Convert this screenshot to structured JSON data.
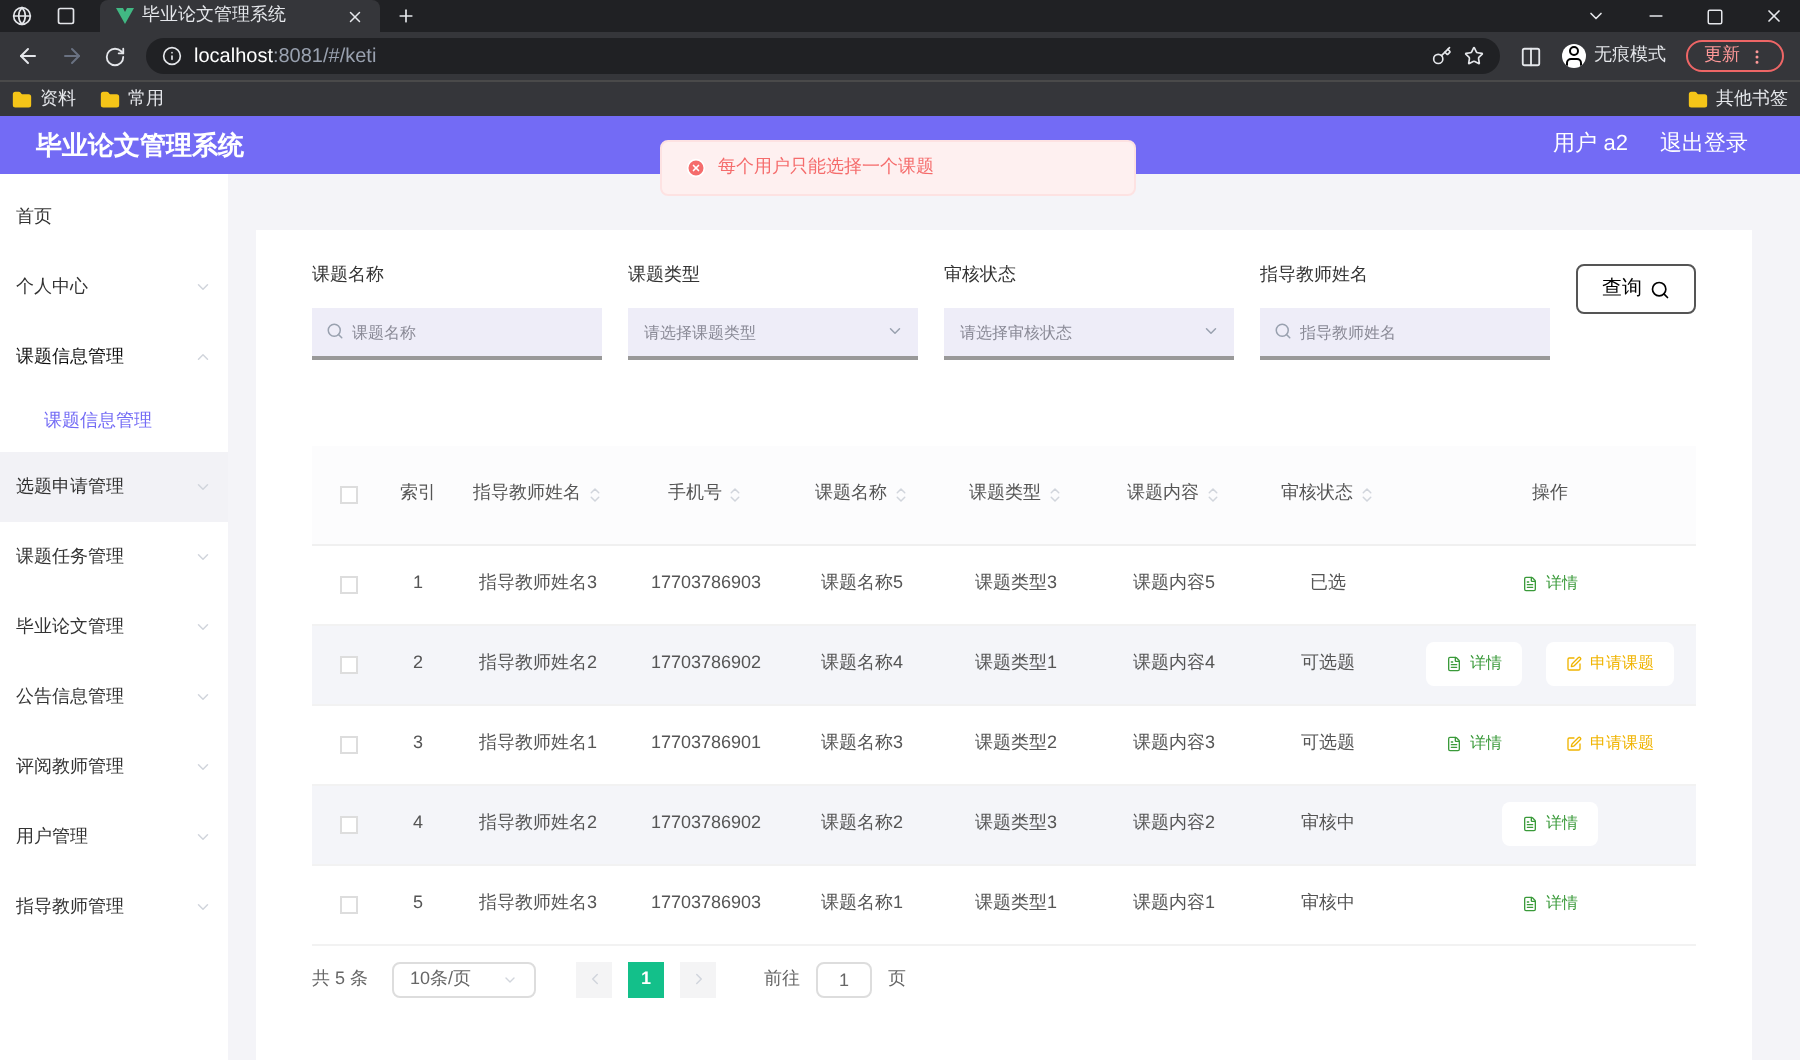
{
  "browser": {
    "tab_title": "毕业论文管理系统",
    "url_host": "localhost",
    "url_rest": ":8081/#/keti",
    "incognito_label": "无痕模式",
    "update_label": "更新",
    "bookmarks": [
      "资料",
      "常用"
    ],
    "other_bookmarks": "其他书签"
  },
  "header": {
    "title": "毕业论文管理系统",
    "user": "用户 a2",
    "logout": "退出登录"
  },
  "toast": {
    "kind": "error",
    "text": "每个用户只能选择一个课题"
  },
  "sidebar": [
    {
      "label": "首页",
      "expanded": false,
      "hovered": false,
      "has_arrow": false
    },
    {
      "label": "个人中心",
      "expanded": false,
      "hovered": false,
      "has_arrow": true
    },
    {
      "label": "课题信息管理",
      "expanded": true,
      "hovered": false,
      "has_arrow": true,
      "children": [
        {
          "label": "课题信息管理",
          "selected": true
        }
      ]
    },
    {
      "label": "选题申请管理",
      "expanded": false,
      "hovered": true,
      "has_arrow": true
    },
    {
      "label": "课题任务管理",
      "expanded": false,
      "hovered": false,
      "has_arrow": true
    },
    {
      "label": "毕业论文管理",
      "expanded": false,
      "hovered": false,
      "has_arrow": true
    },
    {
      "label": "公告信息管理",
      "expanded": false,
      "hovered": false,
      "has_arrow": true
    },
    {
      "label": "评阅教师管理",
      "expanded": false,
      "hovered": false,
      "has_arrow": true
    },
    {
      "label": "用户管理",
      "expanded": false,
      "hovered": false,
      "has_arrow": true
    },
    {
      "label": "指导教师管理",
      "expanded": false,
      "hovered": false,
      "has_arrow": true
    }
  ],
  "filters": [
    {
      "kind": "input",
      "label": "课题名称",
      "placeholder": "课题名称"
    },
    {
      "kind": "select",
      "label": "课题类型",
      "placeholder": "请选择课题类型"
    },
    {
      "kind": "select",
      "label": "审核状态",
      "placeholder": "请选择审核状态"
    },
    {
      "kind": "input",
      "label": "指导教师姓名",
      "placeholder": "指导教师姓名"
    }
  ],
  "search_button": "查询",
  "table": {
    "all_checked": false,
    "columns": [
      {
        "label": "索引",
        "sortable": false
      },
      {
        "label": "指导教师姓名",
        "sortable": true
      },
      {
        "label": "手机号",
        "sortable": true
      },
      {
        "label": "课题名称",
        "sortable": true
      },
      {
        "label": "课题类型",
        "sortable": true
      },
      {
        "label": "课题内容",
        "sortable": true
      },
      {
        "label": "审核状态",
        "sortable": true
      },
      {
        "label": "操作",
        "sortable": false
      }
    ],
    "rows": [
      {
        "checked": false,
        "cells": [
          "1",
          "指导教师姓名3",
          "17703786903",
          "课题名称5",
          "课题类型3",
          "课题内容5",
          "已选"
        ],
        "actions": [
          {
            "kind": "detail",
            "label": "详情"
          }
        ]
      },
      {
        "checked": false,
        "cells": [
          "2",
          "指导教师姓名2",
          "17703786902",
          "课题名称4",
          "课题类型1",
          "课题内容4",
          "可选题"
        ],
        "actions": [
          {
            "kind": "detail",
            "label": "详情"
          },
          {
            "kind": "apply",
            "label": "申请课题"
          }
        ]
      },
      {
        "checked": false,
        "cells": [
          "3",
          "指导教师姓名1",
          "17703786901",
          "课题名称3",
          "课题类型2",
          "课题内容3",
          "可选题"
        ],
        "actions": [
          {
            "kind": "detail",
            "label": "详情"
          },
          {
            "kind": "apply",
            "label": "申请课题"
          }
        ]
      },
      {
        "checked": false,
        "cells": [
          "4",
          "指导教师姓名2",
          "17703786902",
          "课题名称2",
          "课题类型3",
          "课题内容2",
          "审核中"
        ],
        "actions": [
          {
            "kind": "detail",
            "label": "详情"
          }
        ]
      },
      {
        "checked": false,
        "cells": [
          "5",
          "指导教师姓名3",
          "17703786903",
          "课题名称1",
          "课题类型1",
          "课题内容1",
          "审核中"
        ],
        "actions": [
          {
            "kind": "detail",
            "label": "详情"
          }
        ]
      }
    ]
  },
  "pagination": {
    "total": "共 5 条",
    "page_size": "10条/页",
    "pages": [
      {
        "label": "1",
        "selected": true
      }
    ],
    "goto_label": "前往",
    "goto_value": "1",
    "page_unit": "页"
  }
}
